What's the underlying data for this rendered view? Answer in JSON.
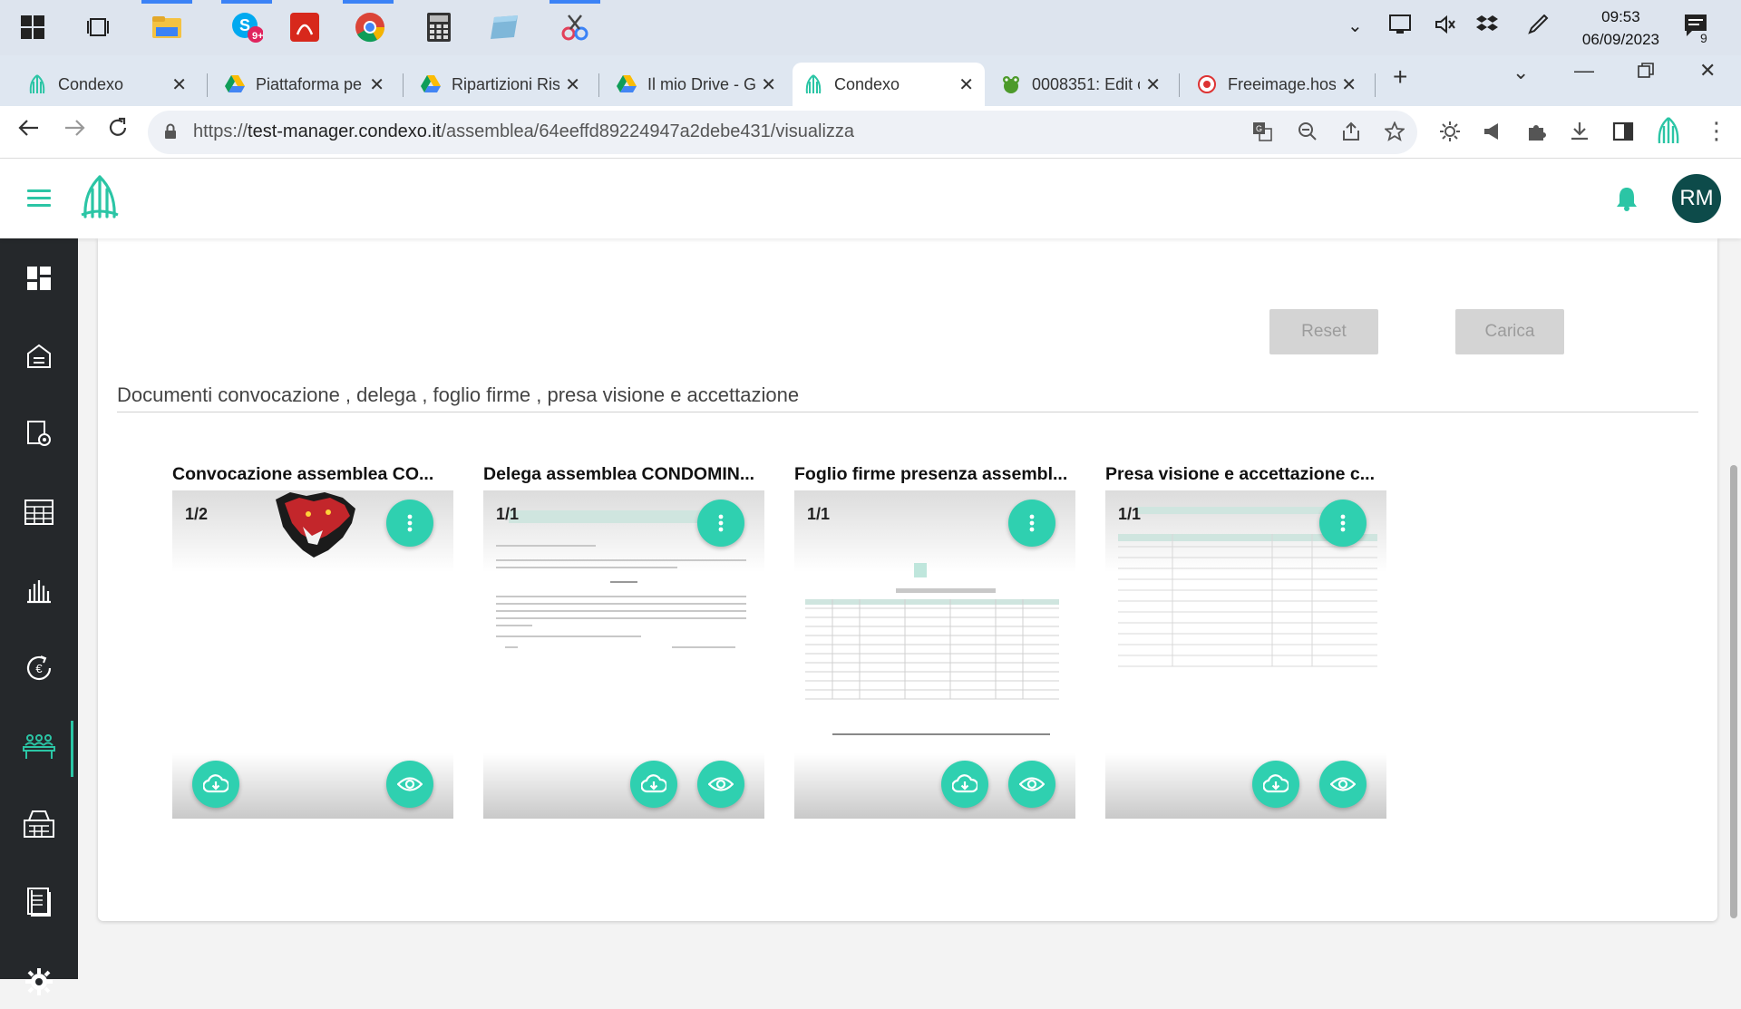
{
  "taskbar": {
    "apps": [
      "start-icon",
      "task-view-icon",
      "file-explorer-icon",
      "skype-icon",
      "acrobat-icon",
      "chrome-icon",
      "calculator-icon",
      "notes-icon",
      "snipping-icon"
    ],
    "skype_badge": "9+",
    "time": "09:53",
    "date": "06/09/2023",
    "notification_count": "9"
  },
  "tabs": [
    {
      "title": "Condexo",
      "active": false
    },
    {
      "title": "Piattaforma pe",
      "active": false
    },
    {
      "title": "Ripartizioni Ris",
      "active": false
    },
    {
      "title": "Il mio Drive - G",
      "active": false
    },
    {
      "title": "Condexo",
      "active": true
    },
    {
      "title": "0008351: Edit c",
      "active": false
    },
    {
      "title": "Freeimage.hos",
      "active": false
    }
  ],
  "address": {
    "url_prefix": "https://",
    "url_host": "test-manager.condexo.it",
    "url_path": "/assemblea/64eeffd89224947a2debe431/visualizza"
  },
  "header": {
    "avatar_initials": "RM"
  },
  "main": {
    "reset_label": "Reset",
    "carica_label": "Carica",
    "section_title": "Documenti convocazione , delega , foglio firme , presa visione e accettazione",
    "documents": [
      {
        "title": "Convocazione assemblea CO...",
        "pages": "1/2"
      },
      {
        "title": "Delega assemblea CONDOMIN...",
        "pages": "1/1"
      },
      {
        "title": "Foglio firme presenza assembl...",
        "pages": "1/1"
      },
      {
        "title": "Presa visione e accettazione c...",
        "pages": "1/1"
      }
    ]
  },
  "colors": {
    "accent": "#2fd0b0",
    "sidebar": "#25282b",
    "avatar": "#0d4b4a"
  }
}
